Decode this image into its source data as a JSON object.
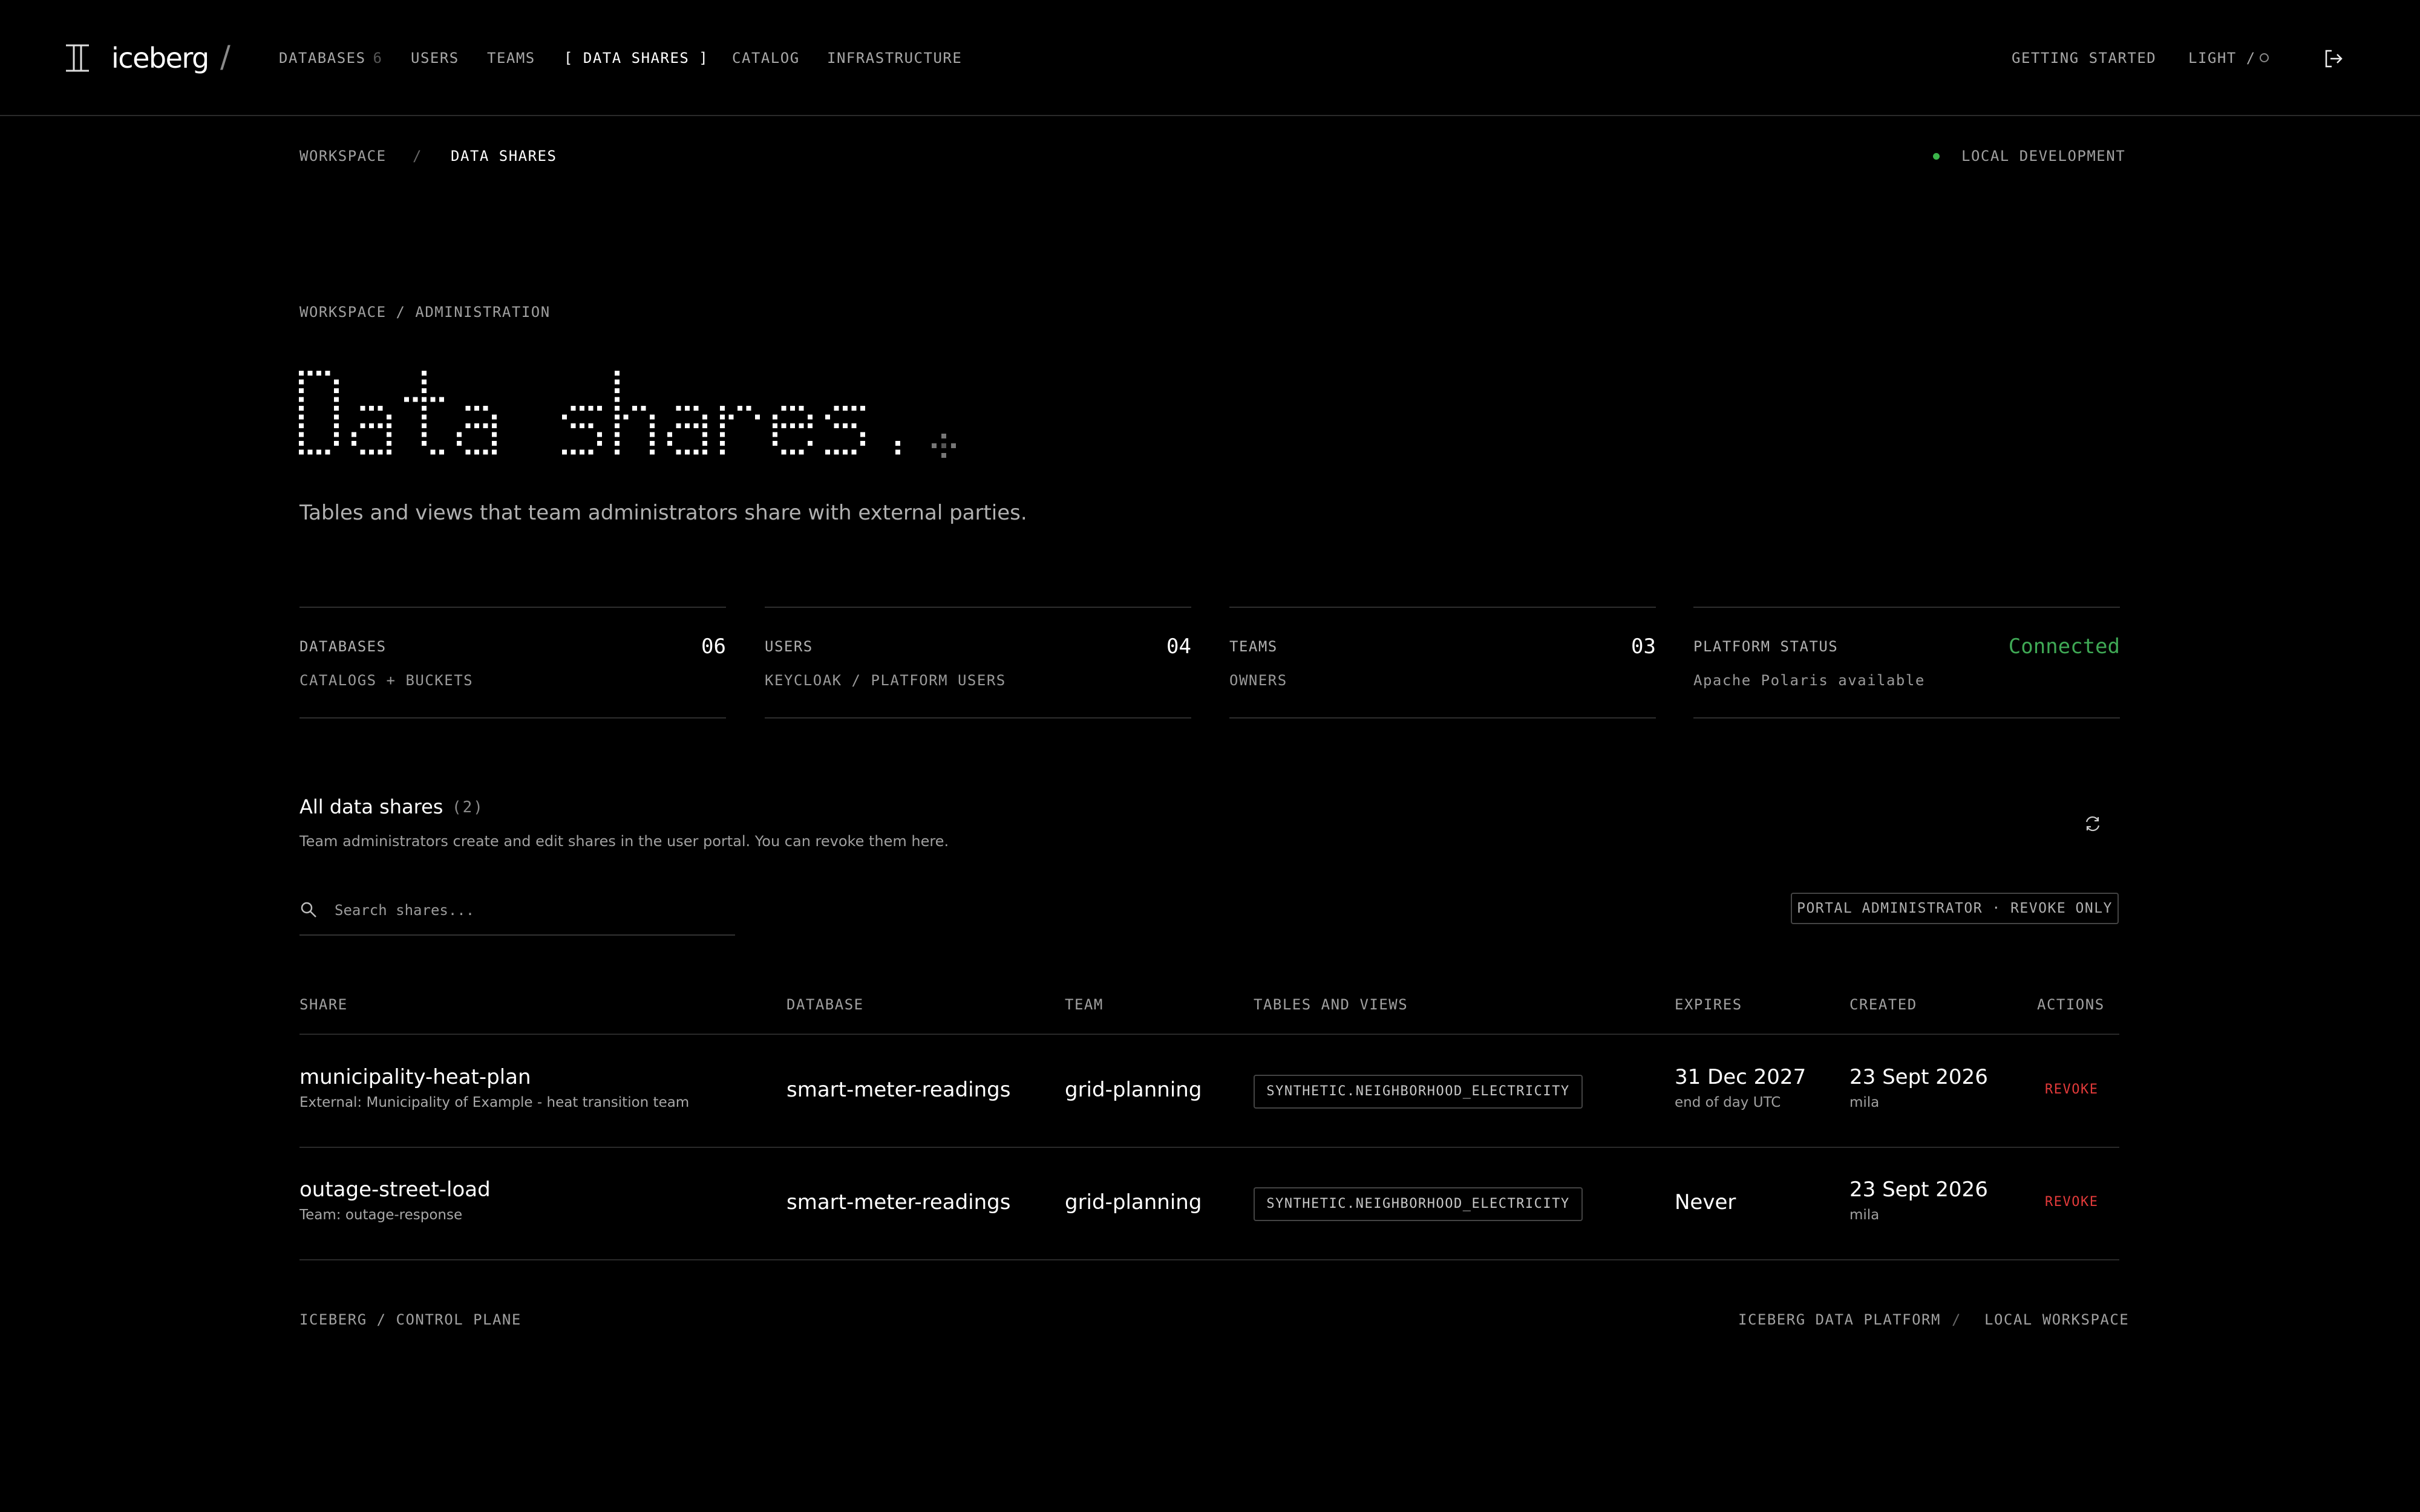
{
  "nav": {
    "brand": "iceberg",
    "brand_separator": "/",
    "items": [
      {
        "label": "DATABASES",
        "count": "6"
      },
      {
        "label": "USERS"
      },
      {
        "label": "TEAMS"
      },
      {
        "label": "[ DATA SHARES ]"
      },
      {
        "label": "CATALOG"
      },
      {
        "label": "INFRASTRUCTURE"
      }
    ],
    "getting_started": "GETTING STARTED",
    "theme_label": "LIGHT /",
    "logout_icon": "logout-icon"
  },
  "breadcrumb": {
    "root": "WORKSPACE",
    "separator": "/",
    "current": "DATA SHARES"
  },
  "environment": {
    "label": "LOCAL DEVELOPMENT",
    "status_color": "#3bb54a"
  },
  "hero": {
    "eyebrow": "WORKSPACE / ADMINISTRATION",
    "title": "Data shares.",
    "subtitle": "Tables and views that team administrators share with external parties."
  },
  "stats": [
    {
      "label": "DATABASES",
      "value": "06",
      "sub": "CATALOGS + BUCKETS"
    },
    {
      "label": "USERS",
      "value": "04",
      "sub": "KEYCLOAK / PLATFORM USERS"
    },
    {
      "label": "TEAMS",
      "value": "03",
      "sub": "OWNERS"
    },
    {
      "label": "PLATFORM STATUS",
      "value": "Connected",
      "sub": "Apache Polaris available"
    }
  ],
  "section": {
    "title": "All data shares",
    "count": "(2)",
    "description": "Team administrators create and edit shares in the user portal. You can revoke them here.",
    "refresh_icon": "refresh-icon"
  },
  "search": {
    "placeholder": "Search shares...",
    "value": ""
  },
  "role_badge": "PORTAL ADMINISTRATOR · REVOKE ONLY",
  "table": {
    "columns": [
      "SHARE",
      "DATABASE",
      "TEAM",
      "TABLES AND VIEWS",
      "EXPIRES",
      "CREATED",
      "ACTIONS"
    ],
    "rows": [
      {
        "share": "municipality-heat-plan",
        "share_sub": "External: Municipality of Example - heat transition team",
        "database": "smart-meter-readings",
        "team": "grid-planning",
        "tables": "SYNTHETIC.NEIGHBORHOOD_ELECTRICITY",
        "expires": "31 Dec 2027",
        "expires_sub": "end of day UTC",
        "created": "23 Sept 2026",
        "created_by": "mila",
        "action": "REVOKE"
      },
      {
        "share": "outage-street-load",
        "share_sub": "Team: outage-response",
        "database": "smart-meter-readings",
        "team": "grid-planning",
        "tables": "SYNTHETIC.NEIGHBORHOOD_ELECTRICITY",
        "expires": "Never",
        "expires_sub": "",
        "created": "23 Sept 2026",
        "created_by": "mila",
        "action": "REVOKE"
      }
    ]
  },
  "footer": {
    "left": "ICEBERG / CONTROL PLANE",
    "right_1": "ICEBERG DATA PLATFORM",
    "separator": "/",
    "right_2": "LOCAL WORKSPACE"
  },
  "colors": {
    "background": "#000000",
    "accent_ok": "#3fa955",
    "danger": "#e23a3a"
  }
}
